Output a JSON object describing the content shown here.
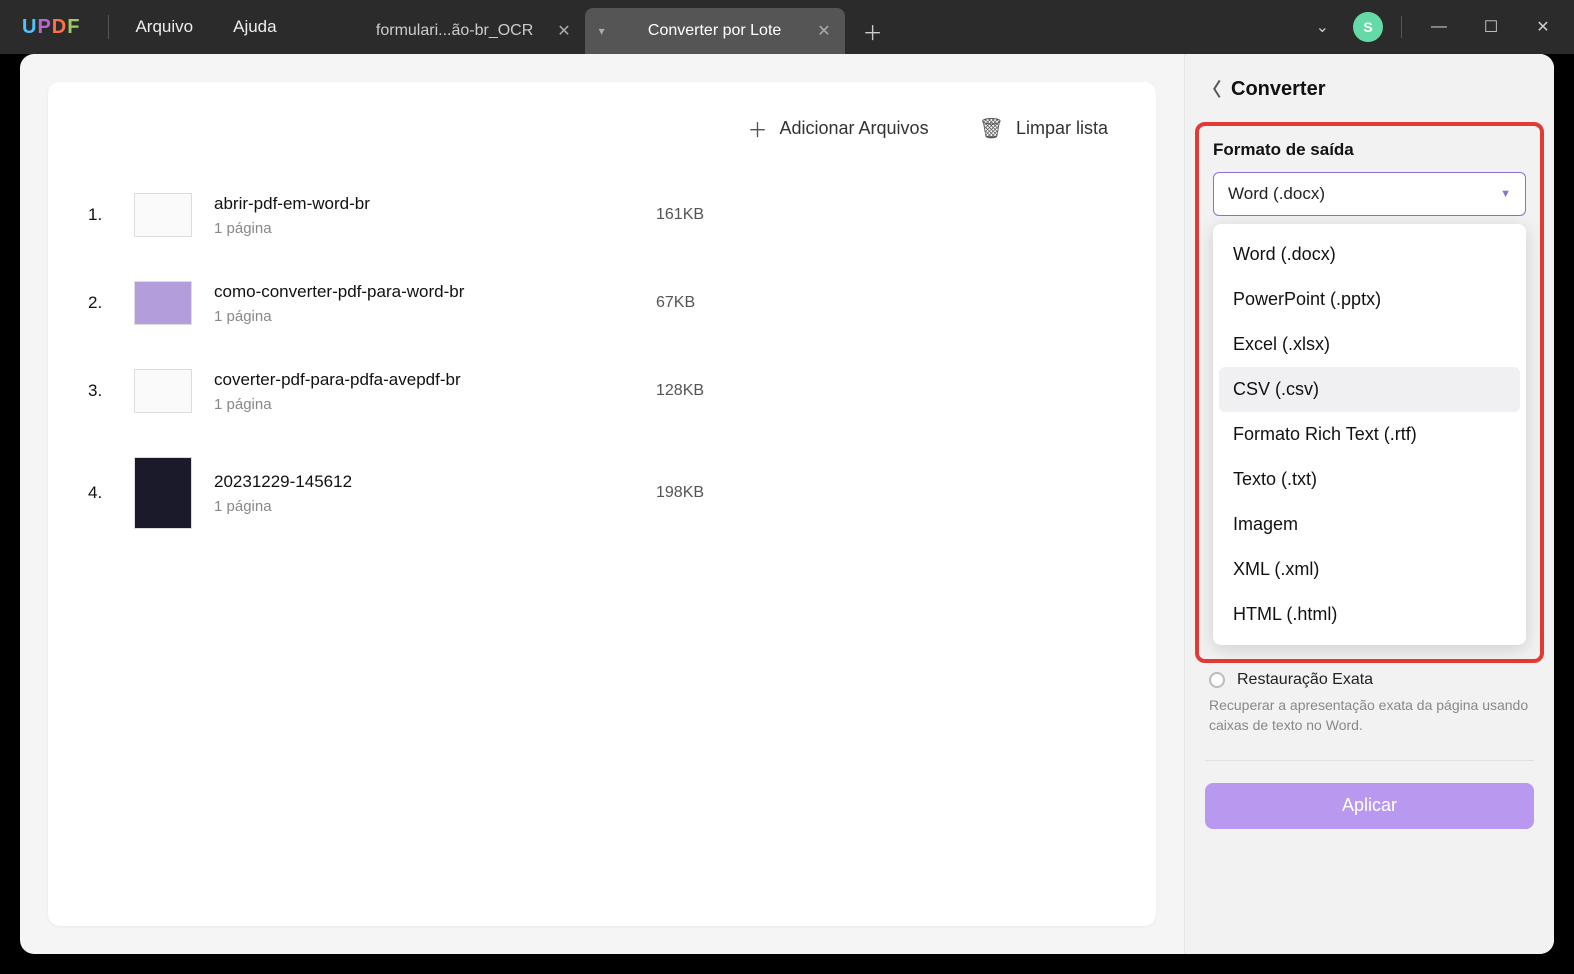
{
  "app": {
    "logo_letters": [
      "U",
      "P",
      "D",
      "F"
    ]
  },
  "menus": {
    "file": "Arquivo",
    "help": "Ajuda"
  },
  "tabs": {
    "inactive": {
      "label": "formulari...ão-br_OCR"
    },
    "active": {
      "label": "Converter por Lote"
    }
  },
  "avatar": {
    "initial": "S"
  },
  "fileList": {
    "addFiles": "Adicionar Arquivos",
    "clearList": "Limpar lista",
    "items": [
      {
        "index": "1.",
        "name": "abrir-pdf-em-word-br",
        "pages": "1 página",
        "size": "161KB",
        "thumb": "plain"
      },
      {
        "index": "2.",
        "name": "como-converter-pdf-para-word-br",
        "pages": "1 página",
        "size": "67KB",
        "thumb": "purple"
      },
      {
        "index": "3.",
        "name": "coverter-pdf-para-pdfa-avepdf-br",
        "pages": "1 página",
        "size": "128KB",
        "thumb": "plain"
      },
      {
        "index": "4.",
        "name": "20231229-145612",
        "pages": "1 página",
        "size": "198KB",
        "thumb": "dark"
      }
    ]
  },
  "sidebar": {
    "title": "Converter",
    "formatLabel": "Formato de saída",
    "selected": "Word (.docx)",
    "options": [
      "Word (.docx)",
      "PowerPoint (.pptx)",
      "Excel (.xlsx)",
      "CSV (.csv)",
      "Formato Rich Text (.rtf)",
      "Texto (.txt)",
      "Imagem",
      "XML (.xml)",
      "HTML (.html)"
    ],
    "hoverIndex": 3,
    "radioLabel": "Restauração Exata",
    "helper": "Recuperar a apresentação exata da página usando caixas de texto no Word.",
    "applyLabel": "Aplicar"
  }
}
